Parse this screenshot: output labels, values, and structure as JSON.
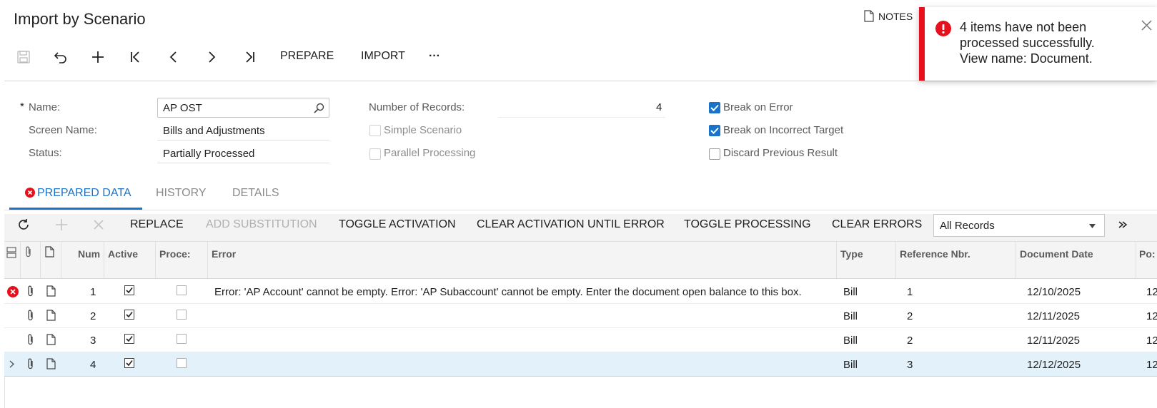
{
  "page": {
    "title": "Import by Scenario",
    "notes_label": "NOTES"
  },
  "toolbar": {
    "prepare_label": "PREPARE",
    "import_label": "IMPORT",
    "more_label": "···"
  },
  "form": {
    "name_label": "Name:",
    "name_value": "AP OST",
    "screen_label": "Screen Name:",
    "screen_value": "Bills and Adjustments",
    "status_label": "Status:",
    "status_value": "Partially Processed",
    "records_label": "Number of Records:",
    "records_value": "4",
    "simple_label": "Simple Scenario",
    "parallel_label": "Parallel Processing",
    "break_error_label": "Break on Error",
    "break_target_label": "Break on Incorrect Target",
    "discard_label": "Discard Previous Result"
  },
  "tabs": {
    "prepared": "PREPARED DATA",
    "history": "HISTORY",
    "details": "DETAILS"
  },
  "grid_toolbar": {
    "replace": "REPLACE",
    "add_sub": "ADD SUBSTITUTION",
    "toggle_act": "TOGGLE ACTIVATION",
    "clear_act": "CLEAR ACTIVATION UNTIL ERROR",
    "toggle_proc": "TOGGLE PROCESSING",
    "clear_err": "CLEAR ERRORS",
    "filter_value": "All Records"
  },
  "grid": {
    "headers": {
      "num": "Num",
      "active": "Active",
      "proc": "Proce:",
      "error": "Error",
      "type": "Type",
      "ref": "Reference Nbr.",
      "date": "Document Date",
      "pos": "Po:"
    },
    "rows": [
      {
        "num": "1",
        "error": "Error: 'AP Account' cannot be empty. Error: 'AP Subaccount' cannot be empty. Enter the document open balance to this box.",
        "type": "Bill",
        "ref": "1",
        "date": "12/10/2025",
        "pos": "12"
      },
      {
        "num": "2",
        "error": "",
        "type": "Bill",
        "ref": "2",
        "date": "12/11/2025",
        "pos": "12"
      },
      {
        "num": "3",
        "error": "",
        "type": "Bill",
        "ref": "2",
        "date": "12/11/2025",
        "pos": "12"
      },
      {
        "num": "4",
        "error": "",
        "type": "Bill",
        "ref": "3",
        "date": "12/12/2025",
        "pos": "12"
      }
    ]
  },
  "toast": {
    "line1": "4 items have not been",
    "line2": "processed successfully.",
    "line3": "View name: Document."
  },
  "colors": {
    "accent": "#1a73c8",
    "error": "#e8101c",
    "selected_row": "#e3f1fa"
  }
}
